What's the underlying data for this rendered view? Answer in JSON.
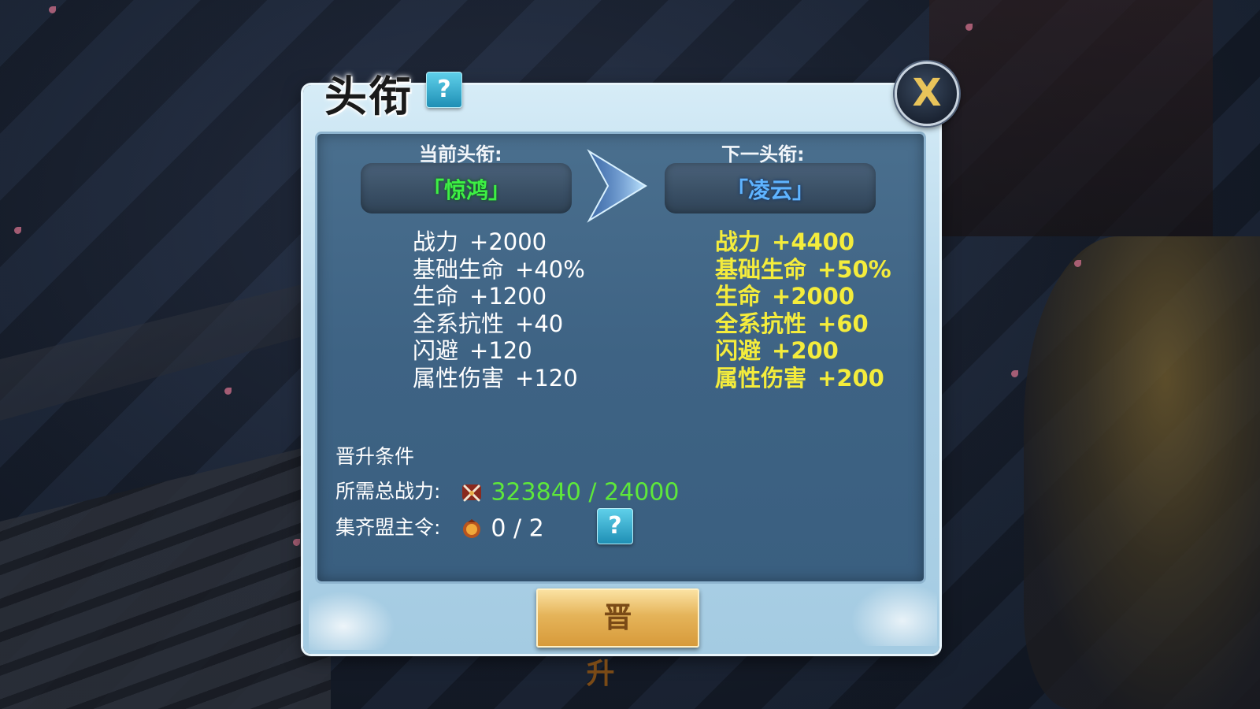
{
  "window": {
    "title": "头衔"
  },
  "header": {
    "help_label": "?",
    "close_label": "X"
  },
  "current": {
    "label": "当前头衔:",
    "rank": "「惊鸿」",
    "stats": [
      {
        "name": "战力",
        "value": "+2000"
      },
      {
        "name": "基础生命",
        "value": "+40%"
      },
      {
        "name": "生命",
        "value": "+1200"
      },
      {
        "name": "全系抗性",
        "value": "+40"
      },
      {
        "name": "闪避",
        "value": "+120"
      },
      {
        "name": "属性伤害",
        "value": "+120"
      }
    ]
  },
  "next": {
    "label": "下一头衔:",
    "rank": "「凌云」",
    "stats": [
      {
        "name": "战力",
        "value": "+4400"
      },
      {
        "name": "基础生命",
        "value": "+50%"
      },
      {
        "name": "生命",
        "value": "+2000"
      },
      {
        "name": "全系抗性",
        "value": "+60"
      },
      {
        "name": "闪避",
        "value": "+200"
      },
      {
        "name": "属性伤害",
        "value": "+200"
      }
    ]
  },
  "conditions": {
    "heading": "晋升条件",
    "power": {
      "label": "所需总战力:",
      "value": "323840 / 24000",
      "icon": "crossed-swords-icon"
    },
    "token": {
      "label": "集齐盟主令:",
      "value": "0 / 2",
      "icon": "token-icon",
      "help_label": "?"
    }
  },
  "actions": {
    "promote_label": "晋升"
  },
  "colors": {
    "current_rank": "#3df044",
    "next_rank": "#5fb4ff",
    "next_stats": "#f4ec3c",
    "power_value": "#5ee83a",
    "close_x": "#e9c45a"
  }
}
